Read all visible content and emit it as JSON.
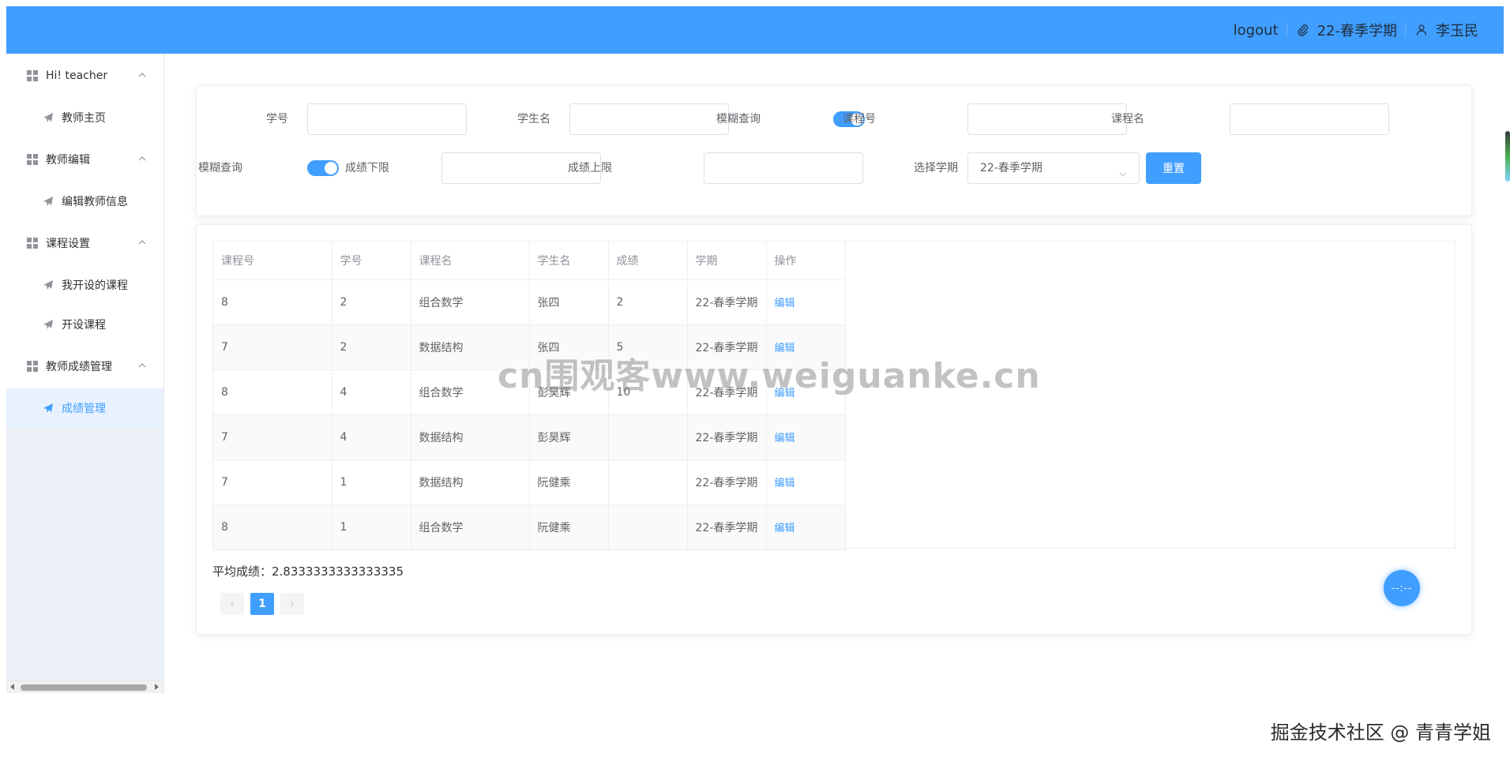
{
  "header": {
    "logout_label": "logout",
    "semester": "22-春季学期",
    "user_name": "李玉民"
  },
  "sidebar": {
    "groups": [
      {
        "label": "Hi! teacher",
        "items": [
          {
            "label": "教师主页"
          }
        ]
      },
      {
        "label": "教师编辑",
        "items": [
          {
            "label": "编辑教师信息"
          }
        ]
      },
      {
        "label": "课程设置",
        "items": [
          {
            "label": "我开设的课程"
          },
          {
            "label": "开设课程"
          }
        ]
      },
      {
        "label": "教师成绩管理",
        "items": [
          {
            "label": "成绩管理",
            "active": true
          }
        ]
      }
    ]
  },
  "filters": {
    "student_id_label": "学号",
    "student_name_label": "学生名",
    "fuzzy_label_1": "模糊查询",
    "course_id_label": "课程号",
    "course_name_label": "课程名",
    "fuzzy_label_2": "模糊查询",
    "score_min_label": "成绩下限",
    "score_max_label": "成绩上限",
    "semester_label": "选择学期",
    "semester_value": "22-春季学期",
    "reset_label": "重置",
    "fuzzy_1_on": true,
    "fuzzy_2_on": true
  },
  "table": {
    "columns": [
      "课程号",
      "学号",
      "课程名",
      "学生名",
      "成绩",
      "学期",
      "操作"
    ],
    "rows": [
      {
        "course_id": "8",
        "student_id": "2",
        "course_name": "组合数学",
        "student_name": "张四",
        "score": "2",
        "semester": "22-春季学期",
        "action": "编辑"
      },
      {
        "course_id": "7",
        "student_id": "2",
        "course_name": "数据结构",
        "student_name": "张四",
        "score": "5",
        "semester": "22-春季学期",
        "action": "编辑"
      },
      {
        "course_id": "8",
        "student_id": "4",
        "course_name": "组合数学",
        "student_name": "彭昊辉",
        "score": "10",
        "semester": "22-春季学期",
        "action": "编辑"
      },
      {
        "course_id": "7",
        "student_id": "4",
        "course_name": "数据结构",
        "student_name": "彭昊辉",
        "score": "",
        "semester": "22-春季学期",
        "action": "编辑"
      },
      {
        "course_id": "7",
        "student_id": "1",
        "course_name": "数据结构",
        "student_name": "阮健乘",
        "score": "",
        "semester": "22-春季学期",
        "action": "编辑"
      },
      {
        "course_id": "8",
        "student_id": "1",
        "course_name": "组合数学",
        "student_name": "阮健乘",
        "score": "",
        "semester": "22-春季学期",
        "action": "编辑"
      }
    ]
  },
  "summary": {
    "average_text": "平均成绩：2.8333333333333335"
  },
  "pagination": {
    "prev": "‹",
    "current": "1",
    "next": "›"
  },
  "float_button_text": "--:--",
  "watermark": "cn围观客www.weiguanke.cn",
  "credit": "掘金技术社区 @ 青青学姐",
  "colors": {
    "primary": "#409eff",
    "sidebar_lower": "#ecf1f8"
  },
  "icons": {
    "header": [
      "paperclip-icon",
      "user-icon"
    ],
    "menu_group": "grid-icon",
    "menu_item": "paper-plane-icon"
  }
}
